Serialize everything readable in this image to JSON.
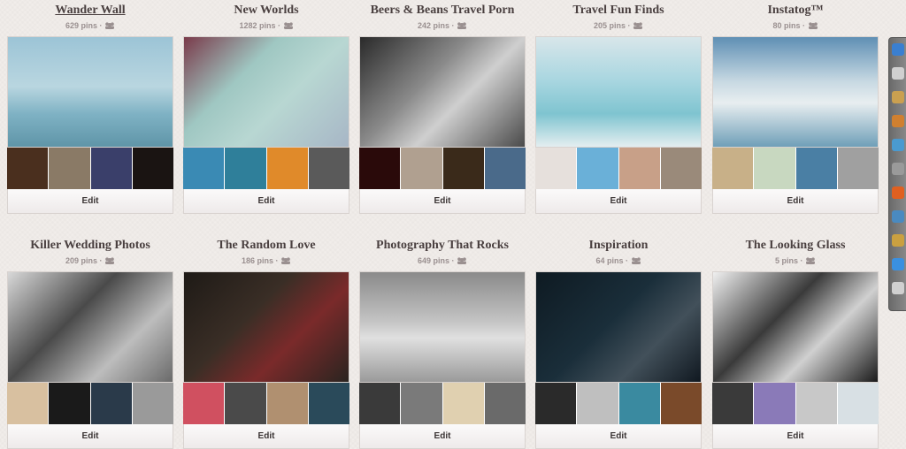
{
  "boards": [
    {
      "title": "Wander Wall",
      "pins": "629 pins",
      "edit": "Edit",
      "underlined": true,
      "cover": "linear-gradient(180deg,#9cc4d6 0%,#b9d6e0 45%,#7fb2c4 70%,#5f95a8 100%)",
      "thumbs": [
        "#4a2f1e",
        "#8a7a66",
        "#3a3f6a",
        "#1a1412"
      ]
    },
    {
      "title": "New Worlds",
      "pins": "1282 pins",
      "edit": "Edit",
      "underlined": false,
      "cover": "linear-gradient(135deg,#7a3a4a 0%,#9fc7c2 35%,#b8d7d2 60%,#a7b6c6 100%)",
      "thumbs": [
        "#3a8ab4",
        "#2f7f9a",
        "#e08a2a",
        "#5a5a5a"
      ]
    },
    {
      "title": "Beers & Beans Travel Porn",
      "pins": "242 pins",
      "edit": "Edit",
      "underlined": false,
      "cover": "linear-gradient(135deg,#2a2a2a 0%,#8a8a8a 40%,#cfcfcf 60%,#4a4a4a 100%)",
      "thumbs": [
        "#2a0a0a",
        "#b0a090",
        "#3a2a1a",
        "#4a6a8a"
      ]
    },
    {
      "title": "Travel Fun Finds",
      "pins": "205 pins",
      "edit": "Edit",
      "underlined": false,
      "cover": "linear-gradient(180deg,#d8e6ea 0%,#a8d6e0 40%,#7fc4d0 70%,#e4eef0 100%)",
      "thumbs": [
        "#e6e0dc",
        "#6ab0d8",
        "#c8a088",
        "#9a8a7a"
      ]
    },
    {
      "title": "Instatog™",
      "pins": "80 pins",
      "edit": "Edit",
      "underlined": false,
      "cover": "linear-gradient(180deg,#5f8fb4 0%,#c6d8e2 40%,#e8eef0 60%,#6f9fb8 100%)",
      "thumbs": [
        "#c8b088",
        "#c8d8c0",
        "#4a7fa4",
        "#a0a0a0"
      ]
    },
    {
      "title": "Killer Wedding Photos",
      "pins": "209 pins",
      "edit": "Edit",
      "underlined": false,
      "cover": "linear-gradient(135deg,#d8d8d8 0%,#4a4a4a 40%,#bdbdbd 70%,#6a6a6a 100%)",
      "thumbs": [
        "#d8c0a0",
        "#1a1a1a",
        "#2a3a4a",
        "#9a9a9a"
      ]
    },
    {
      "title": "The Random Love",
      "pins": "186 pins",
      "edit": "Edit",
      "underlined": false,
      "cover": "linear-gradient(135deg,#1e1a16 0%,#3a2e26 40%,#7a2a2a 65%,#2a2420 100%)",
      "thumbs": [
        "#d05060",
        "#4a4a4a",
        "#b09070",
        "#2a4a5a"
      ]
    },
    {
      "title": "Photography That Rocks",
      "pins": "649 pins",
      "edit": "Edit",
      "underlined": false,
      "cover": "linear-gradient(180deg,#8a8a8a 0%,#c4c4c4 45%,#e0e0e0 60%,#9a9a9a 100%)",
      "thumbs": [
        "#3a3a3a",
        "#7a7a7a",
        "#e0d0b0",
        "#6a6a6a"
      ]
    },
    {
      "title": "Inspiration",
      "pins": "64 pins",
      "edit": "Edit",
      "underlined": false,
      "cover": "linear-gradient(135deg,#0e1a22 0%,#1a2e3a 45%,#42505a 70%,#101820 100%)",
      "thumbs": [
        "#2a2a2a",
        "#bfbfbf",
        "#3a8aa0",
        "#7a4a2a"
      ]
    },
    {
      "title": "The Looking Glass",
      "pins": "5 pins",
      "edit": "Edit",
      "underlined": false,
      "cover": "linear-gradient(135deg,#f0f0f0 0%,#3a3a3a 40%,#d0d0d0 65%,#1a1a1a 100%)",
      "thumbs": [
        "#3a3a3a",
        "#8a7ab8",
        "#c8c8c8",
        "#d8e0e4"
      ]
    }
  ],
  "dock_icons": [
    "#3a7fd0",
    "#d0d0d0",
    "#caa050",
    "#d08030",
    "#4a9ad0",
    "#9a9a9a",
    "#e06020",
    "#4a8ac0",
    "#caa040",
    "#3a90e0",
    "#d0d0d0"
  ]
}
